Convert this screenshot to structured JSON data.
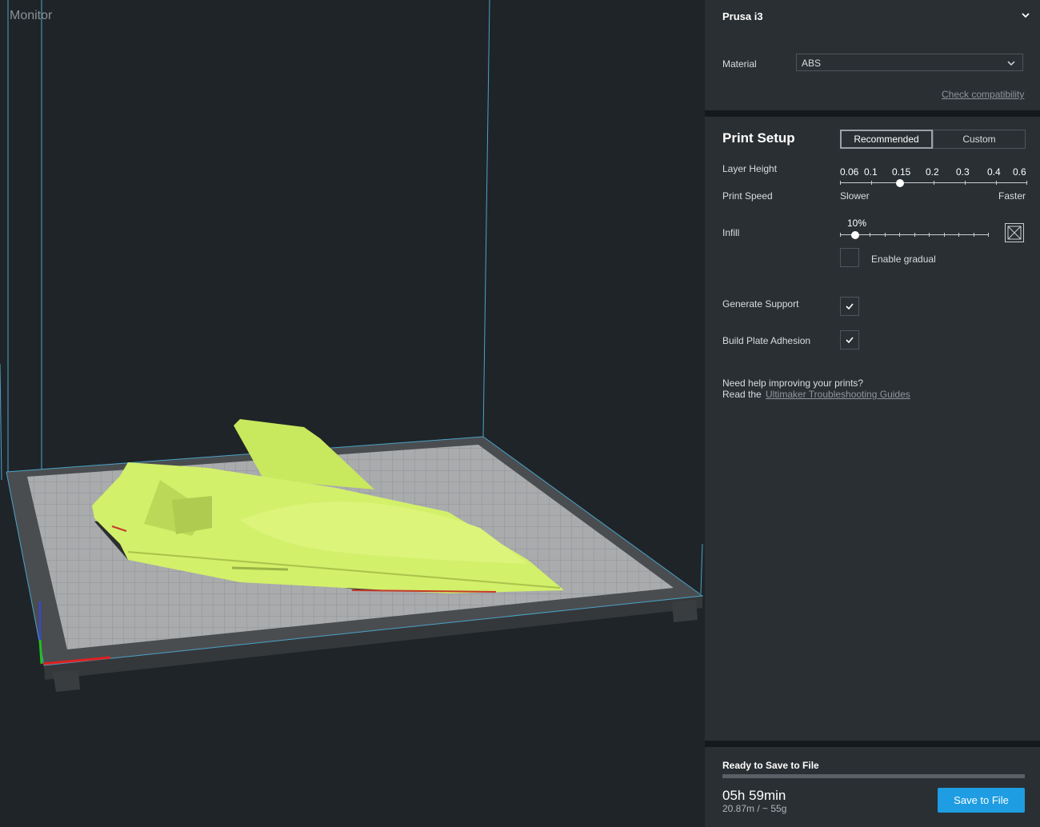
{
  "viewport": {
    "stage_label": "Monitor"
  },
  "machine": {
    "printer_name": "Prusa i3",
    "material_label": "Material",
    "material_value": "ABS",
    "check_compat_link": "Check compatibility"
  },
  "setup": {
    "title": "Print Setup",
    "tabs": [
      "Recommended",
      "Custom"
    ],
    "active_tab": "Recommended",
    "layer_height_label": "Layer Height",
    "layer_heights": [
      "0.06",
      "0.1",
      "0.15",
      "0.2",
      "0.3",
      "0.4",
      "0.6"
    ],
    "layer_height_selected": "0.15",
    "print_speed_label": "Print Speed",
    "slower_label": "Slower",
    "faster_label": "Faster",
    "infill_label": "Infill",
    "infill_value": "10%",
    "infill_fraction": 0.1,
    "enable_gradual_label": "Enable gradual",
    "enable_gradual_checked": false,
    "generate_support_label": "Generate Support",
    "generate_support_checked": true,
    "build_plate_label": "Build Plate Adhesion",
    "build_plate_checked": true,
    "help_line1": "Need help improving your prints?",
    "help_line2_prefix": "Read the",
    "help_link": "Ultimaker Troubleshooting Guides"
  },
  "status": {
    "title": "Ready to Save to File",
    "time": "05h 59min",
    "material_usage": "20.87m / ~ 55g",
    "save_button": "Save to File",
    "progress": 1.0
  },
  "colors": {
    "accent": "#1e9de2",
    "model": "#d2f06a",
    "panel_bg": "#2a2f33",
    "viewport_bg": "#1f2428"
  }
}
